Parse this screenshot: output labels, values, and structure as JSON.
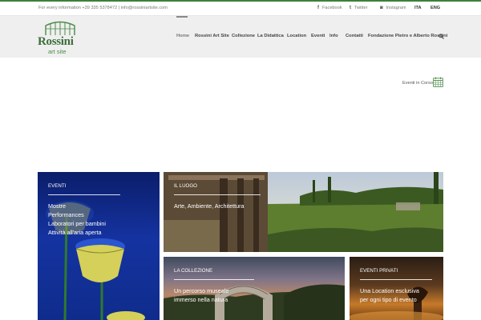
{
  "topbar": {
    "info": "For every information +39 335 5378472  |  info@rossiniartsite.com",
    "social": [
      {
        "icon": "facebook-icon",
        "glyph": "f",
        "label": "Facebook"
      },
      {
        "icon": "twitter-icon",
        "glyph": "t",
        "label": "Twitter"
      },
      {
        "icon": "instagram-icon",
        "glyph": "◙",
        "label": "Instagram"
      }
    ],
    "languages": [
      "ITA",
      "ENG"
    ]
  },
  "logo": {
    "name": "Rossini",
    "sub": "art site",
    "color": "#3c6e3a"
  },
  "nav": {
    "items": [
      "Home",
      "Rossini Art Site",
      "Collezione",
      "La Didattica",
      "Location",
      "Eventi",
      "Info",
      "Contatti",
      "Fondazione Pietro e Alberto Rossini"
    ],
    "active": "Home"
  },
  "eventi_corso": {
    "label": "Eventi in Corso",
    "icon": "calendar-icon"
  },
  "tiles": {
    "eventi": {
      "title": "EVENTI",
      "lines": [
        "Mostre",
        "Performances",
        "Laboratori per bambini",
        "Attività all'aria aperta"
      ]
    },
    "luogo": {
      "title": "IL LUOGO",
      "lines": [
        "Arte, Ambiente, Architettura"
      ]
    },
    "collezione": {
      "title": "LA COLLEZIONE",
      "lines": [
        "Un percorso museale",
        "immerso nella natura"
      ]
    },
    "privati": {
      "title": "EVENTI PRIVATI",
      "lines": [
        "Una Location esclusiva",
        "per ogni tipo di evento"
      ]
    }
  },
  "colors": {
    "accent": "#3f7f3a",
    "header_bg": "#efefef"
  }
}
